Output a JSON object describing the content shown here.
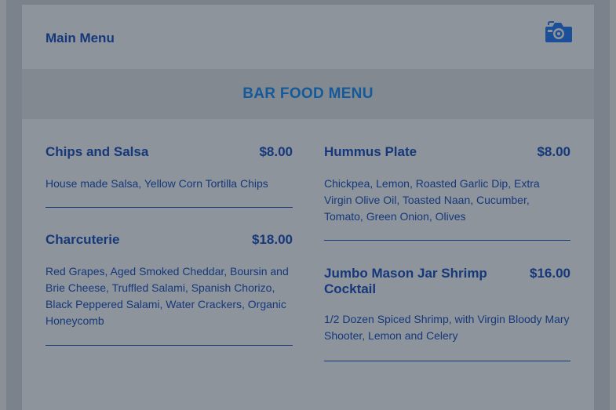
{
  "header": {
    "main_menu_label": "Main Menu",
    "camera_icon": "camera-icon"
  },
  "banner": {
    "title": "BAR FOOD MENU"
  },
  "menu": {
    "left": [
      {
        "name": "Chips and Salsa",
        "price": "$8.00",
        "description": "House made Salsa, Yellow Corn Tortilla Chips"
      },
      {
        "name": "Charcuterie",
        "price": "$18.00",
        "description": "Red Grapes, Aged Smoked Cheddar, Boursin and Brie Cheese, Truffled Salami, Spanish Chorizo, Black Peppered Salami, Water Crackers, Organic Honeycomb"
      }
    ],
    "right": [
      {
        "name": "Hummus Plate",
        "price": "$8.00",
        "description": "Chickpea, Lemon, Roasted Garlic Dip, Extra Virgin Olive Oil, Toasted Naan, Cucumber, Tomato, Green Onion, Olives"
      },
      {
        "name": "Jumbo Mason Jar Shrimp Cocktail",
        "price": "$16.00",
        "description": "1/2 Dozen Spiced Shrimp, with Virgin Bloody Mary Shooter, Lemon and Celery"
      }
    ]
  },
  "colors": {
    "text": "#16387a",
    "title": "#14599a",
    "icon": "#1b4f98"
  }
}
